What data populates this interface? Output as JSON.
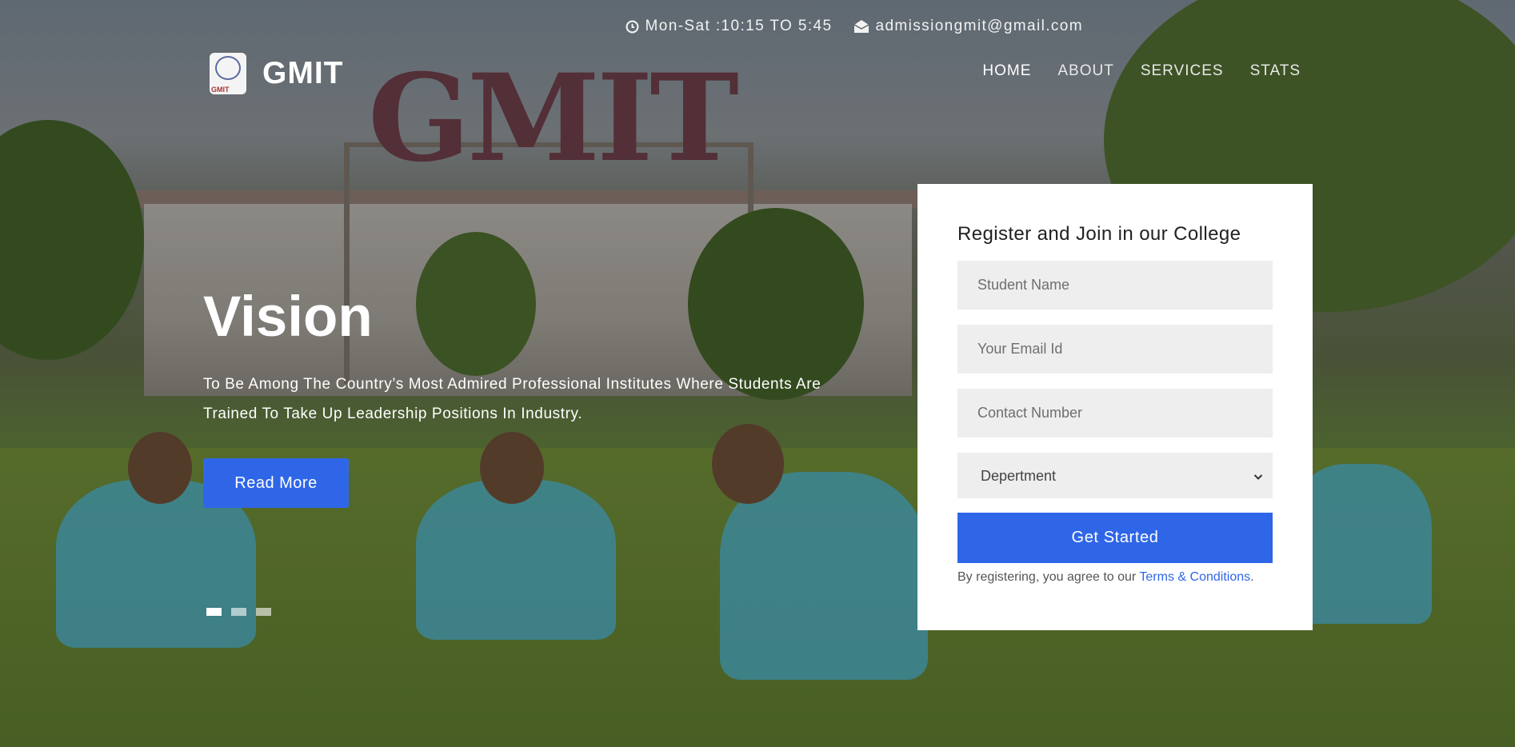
{
  "topbar": {
    "hours": "Mon-Sat :10:15 TO 5:45",
    "email": "admissiongmit@gmail.com"
  },
  "brand": {
    "logo_text": "GMIT",
    "name": "GMIT"
  },
  "nav": {
    "items": [
      {
        "label": "HOME",
        "active": true
      },
      {
        "label": "ABOUT",
        "active": false
      },
      {
        "label": "SERVICES",
        "active": false
      },
      {
        "label": "STATS",
        "active": false
      }
    ]
  },
  "hero": {
    "sign_text": "GMIT",
    "title": "Vision",
    "description": "To Be Among The Country’s Most Admired Professional Institutes Where Students Are Trained To Take Up Leadership Positions In Industry.",
    "button_label": "Read More",
    "slide_count": 3,
    "active_slide": 1
  },
  "register": {
    "heading": "Register and Join in our College",
    "name_placeholder": "Student Name",
    "email_placeholder": "Your Email Id",
    "phone_placeholder": "Contact Number",
    "department_selected": "Depertment",
    "submit_label": "Get Started",
    "terms_prefix": "By registering, you agree to our ",
    "terms_link": "Terms & Conditions",
    "terms_suffix": "."
  },
  "colors": {
    "accent": "#2f66e8",
    "card_bg": "#ffffff",
    "field_bg": "#eeeeee"
  },
  "icons": {
    "hours": "clock-icon",
    "email": "envelope-icon",
    "select": "chevron-down-icon"
  }
}
